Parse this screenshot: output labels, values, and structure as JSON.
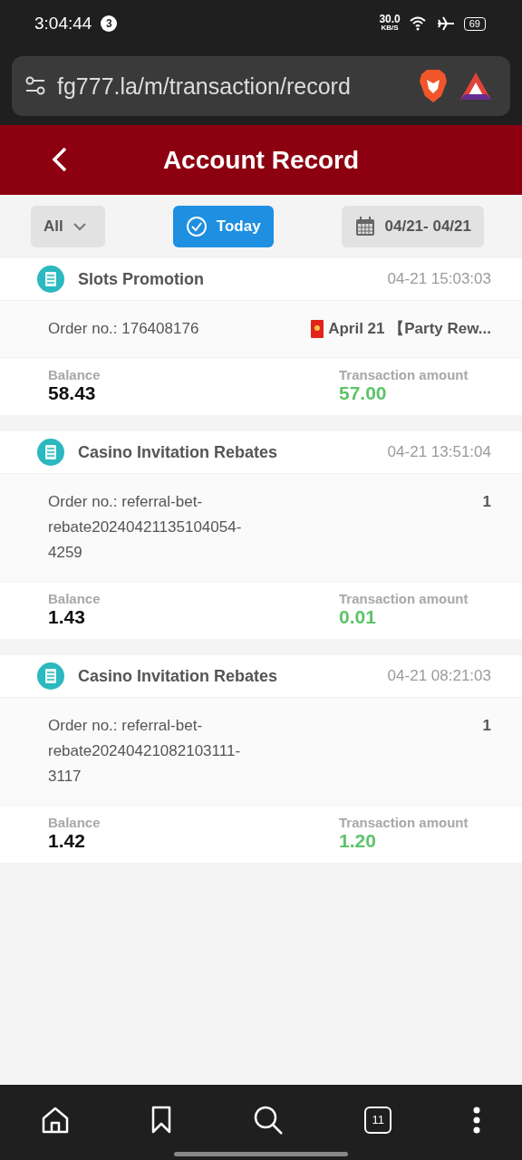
{
  "status_bar": {
    "time": "3:04:44",
    "notification_count": "3",
    "net_speed": "30.0",
    "net_unit": "KB/S",
    "battery": "69"
  },
  "browser": {
    "url": "fg777.la/m/transaction/record",
    "tab_count": "11"
  },
  "header": {
    "title": "Account Record"
  },
  "filters": [
    {
      "kind": "dropdown",
      "label": "All",
      "selected": false
    },
    {
      "kind": "toggle",
      "label": "Today",
      "selected": true
    },
    {
      "kind": "date",
      "label": "04/21- 04/21",
      "selected": false
    }
  ],
  "records": [
    {
      "title": "Slots Promotion",
      "time": "04-21 15:03:03",
      "order": "Order no.: 176408176",
      "remark": "April 21 【Party Rew...",
      "remark_icon": true,
      "balance_label": "Balance",
      "balance": "58.43",
      "amount_label": "Transaction amount",
      "amount": "57.00"
    },
    {
      "title": "Casino Invitation Rebates",
      "time": "04-21 13:51:04",
      "order": "Order no.: referral-bet-rebate20240421135104054-4259",
      "remark": "1",
      "balance_label": "Balance",
      "balance": "1.43",
      "amount_label": "Transaction amount",
      "amount": "0.01"
    },
    {
      "title": "Casino Invitation Rebates",
      "time": "04-21 08:21:03",
      "order": "Order no.: referral-bet-rebate20240421082103111-3117",
      "remark": "1",
      "balance_label": "Balance",
      "balance": "1.42",
      "amount_label": "Transaction amount",
      "amount": "1.20"
    }
  ]
}
